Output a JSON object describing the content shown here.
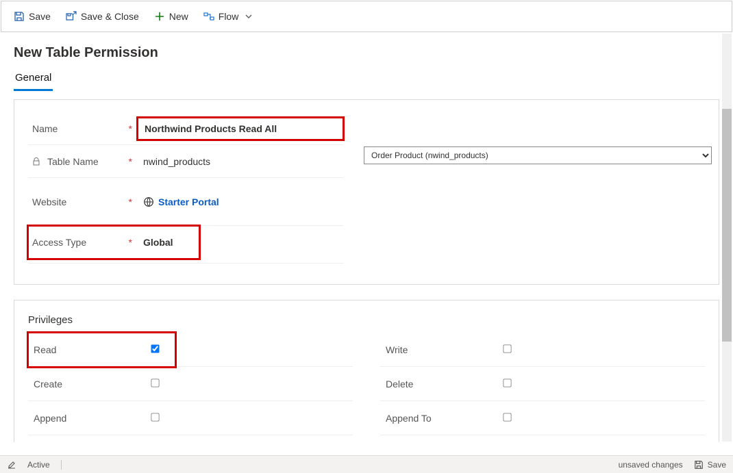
{
  "commands": {
    "save": "Save",
    "save_close": "Save & Close",
    "new": "New",
    "flow": "Flow"
  },
  "page": {
    "title": "New Table Permission"
  },
  "tabs": {
    "general": "General"
  },
  "fields": {
    "name": {
      "label": "Name",
      "value": "Northwind Products Read All"
    },
    "table_name": {
      "label": "Table Name",
      "value": "nwind_products"
    },
    "website": {
      "label": "Website",
      "value": "Starter Portal"
    },
    "access_type": {
      "label": "Access Type",
      "value": "Global"
    },
    "table_lookup_display": "Order Product (nwind_products)"
  },
  "privileges": {
    "section_title": "Privileges",
    "read": {
      "label": "Read",
      "checked": true
    },
    "write": {
      "label": "Write",
      "checked": false
    },
    "create": {
      "label": "Create",
      "checked": false
    },
    "delete": {
      "label": "Delete",
      "checked": false
    },
    "append": {
      "label": "Append",
      "checked": false
    },
    "append_to": {
      "label": "Append To",
      "checked": false
    }
  },
  "status": {
    "active": "Active",
    "unsaved": "unsaved changes",
    "save": "Save"
  }
}
